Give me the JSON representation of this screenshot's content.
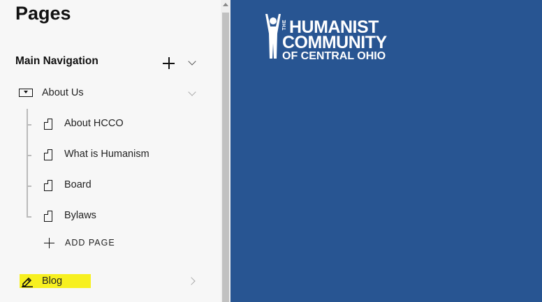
{
  "panel": {
    "title": "Pages",
    "nav_section": "Main Navigation",
    "folder": {
      "label": "About Us"
    },
    "children": [
      {
        "label": "About HCCO"
      },
      {
        "label": "What is Humanism"
      },
      {
        "label": "Board"
      },
      {
        "label": "Bylaws"
      }
    ],
    "add_page_label": "ADD PAGE",
    "blog": {
      "label": "Blog"
    }
  },
  "logo": {
    "the": "THE",
    "line1": "HUMANIST",
    "line2": "COMMUNITY",
    "line3": "OF CENTRAL OHIO"
  },
  "colors": {
    "preview_bg": "#285592",
    "highlight": "#f7f020",
    "panel_bg": "#f7f7f7"
  }
}
